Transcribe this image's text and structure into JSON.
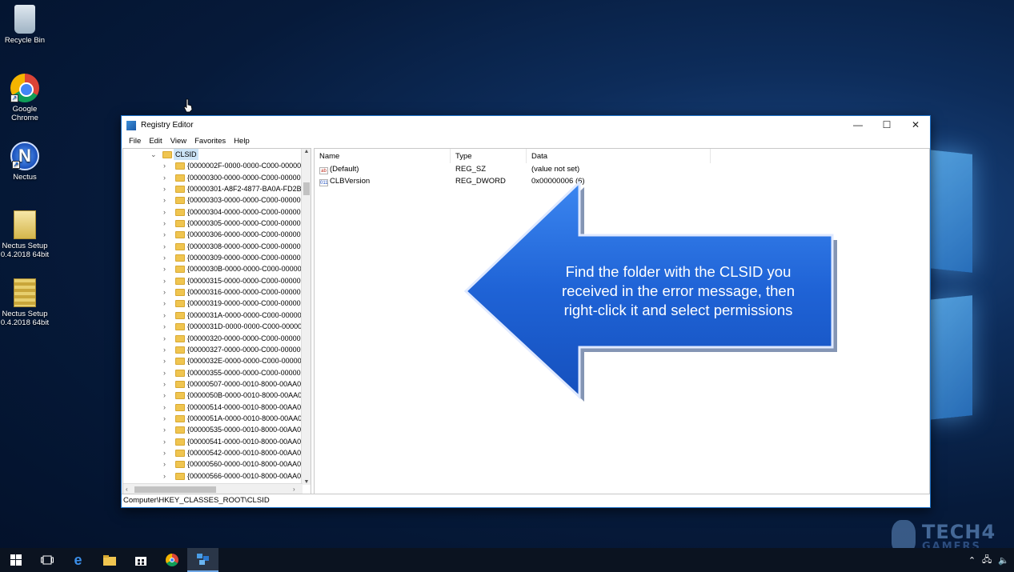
{
  "desktop": {
    "icons": [
      {
        "label": "Recycle Bin",
        "icon": "recycle-bin-icon"
      },
      {
        "label": "Google Chrome",
        "icon": "chrome-icon"
      },
      {
        "label": "Nectus",
        "icon": "nectus-icon"
      },
      {
        "label": "Nectus Setup 0.4.2018 64bit",
        "icon": "setup-file-icon"
      },
      {
        "label": "Nectus Setup 0.4.2018 64bit",
        "icon": "zip-file-icon"
      }
    ]
  },
  "window": {
    "title": "Registry Editor",
    "controls": {
      "minimize": "—",
      "maximize": "☐",
      "close": "✕"
    },
    "menu": [
      "File",
      "Edit",
      "View",
      "Favorites",
      "Help"
    ]
  },
  "tree": {
    "selected": "CLSID",
    "items": [
      "{0000002F-0000-0000-C000-00000",
      "{00000300-0000-0000-C000-00000",
      "{00000301-A8F2-4877-BA0A-FD2B",
      "{00000303-0000-0000-C000-00000",
      "{00000304-0000-0000-C000-00000",
      "{00000305-0000-0000-C000-00000",
      "{00000306-0000-0000-C000-00000",
      "{00000308-0000-0000-C000-00000",
      "{00000309-0000-0000-C000-00000",
      "{0000030B-0000-0000-C000-00000",
      "{00000315-0000-0000-C000-00000",
      "{00000316-0000-0000-C000-00000",
      "{00000319-0000-0000-C000-00000",
      "{0000031A-0000-0000-C000-00000",
      "{0000031D-0000-0000-C000-00000",
      "{00000320-0000-0000-C000-00000",
      "{00000327-0000-0000-C000-00000",
      "{0000032E-0000-0000-C000-00000",
      "{00000355-0000-0000-C000-00000",
      "{00000507-0000-0010-8000-00AA0",
      "{0000050B-0000-0010-8000-00AA0",
      "{00000514-0000-0010-8000-00AA0",
      "{0000051A-0000-0010-8000-00AA0",
      "{00000535-0000-0010-8000-00AA0",
      "{00000541-0000-0010-8000-00AA0",
      "{00000542-0000-0010-8000-00AA0",
      "{00000560-0000-0010-8000-00AA0",
      "{00000566-0000-0010-8000-00AA0"
    ]
  },
  "list": {
    "headers": {
      "name": "Name",
      "type": "Type",
      "data": "Data"
    },
    "rows": [
      {
        "name": "(Default)",
        "type": "REG_SZ",
        "data": "(value not set)",
        "icon": "ab"
      },
      {
        "name": "CLBVersion",
        "type": "REG_DWORD",
        "data": "0x00000006 (6)",
        "icon": "011"
      }
    ]
  },
  "status": {
    "path": "Computer\\HKEY_CLASSES_ROOT\\CLSID"
  },
  "callout": {
    "text": "Find the folder with the CLSID you received in the error message, then right-click it and select permissions"
  },
  "taskbar": {
    "items": [
      "windows-start-icon",
      "task-view-icon",
      "edge-icon",
      "file-explorer-icon",
      "store-icon",
      "chrome-icon",
      "regedit-icon"
    ]
  },
  "watermark": {
    "line1": "TECH4",
    "line2": "GAMERS"
  },
  "colors": {
    "accent": "#1e72c8",
    "arrow": "#1f63d6",
    "selection": "#cce4f7"
  }
}
